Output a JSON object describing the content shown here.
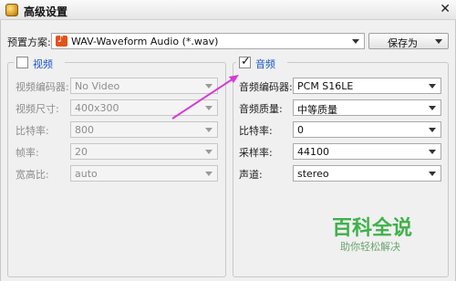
{
  "window": {
    "title": "高级设置",
    "close_symbol": "✕"
  },
  "preset": {
    "label": "预置方案:",
    "value": "WAV-Waveform Audio (*.wav)",
    "save_label": "保存为"
  },
  "video": {
    "legend": "视频",
    "enabled": false,
    "rows": [
      {
        "label": "视频编码器:",
        "value": "No Video"
      },
      {
        "label": "视频尺寸:",
        "value": "400x300"
      },
      {
        "label": "比特率:",
        "value": "800"
      },
      {
        "label": "帧率:",
        "value": "20"
      },
      {
        "label": "宽高比:",
        "value": "auto"
      }
    ]
  },
  "audio": {
    "legend": "音频",
    "enabled": true,
    "check_mark": "✓",
    "rows": [
      {
        "label": "音频编码器:",
        "value": "PCM S16LE"
      },
      {
        "label": "音频质量:",
        "value": "中等质量"
      },
      {
        "label": "比特率:",
        "value": "0"
      },
      {
        "label": "采样率:",
        "value": "44100"
      },
      {
        "label": "声道:",
        "value": "stereo"
      }
    ]
  },
  "watermark": {
    "title": "百科全说",
    "subtitle": "助你轻松解决"
  },
  "colors": {
    "legend_text": "#1a56c6",
    "annotation_arrow": "#d63ad6",
    "watermark": "#3fb14a"
  }
}
